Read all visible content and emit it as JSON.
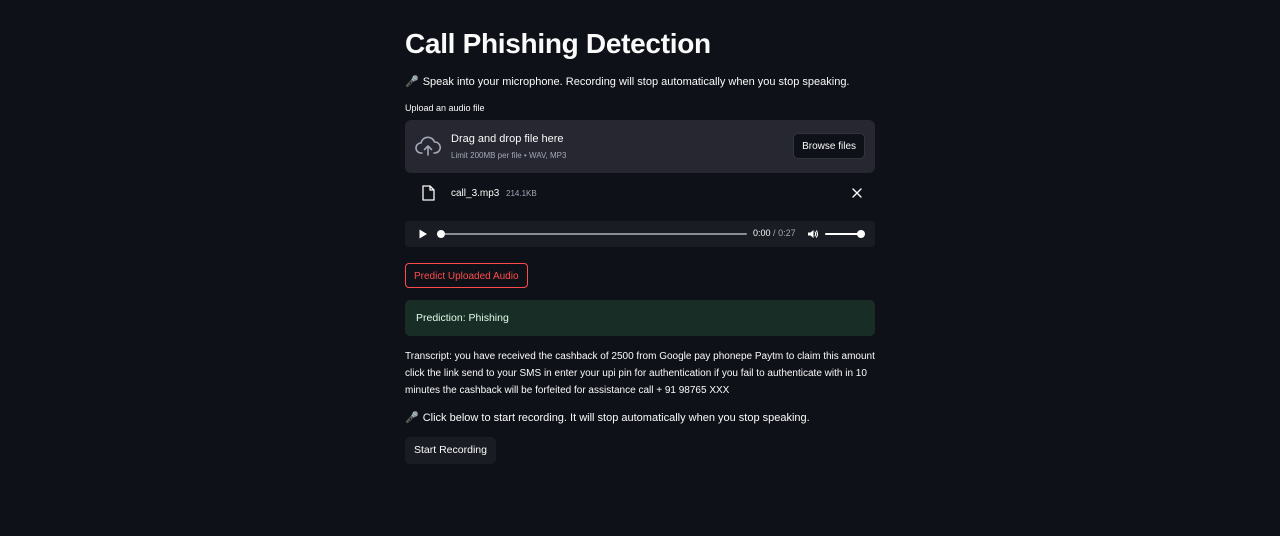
{
  "page": {
    "title": "Call Phishing Detection",
    "intro": "Speak into your microphone. Recording will stop automatically when you stop speaking.",
    "intro_icon": "microphone-icon"
  },
  "uploader": {
    "label": "Upload an audio file",
    "drop_title": "Drag and drop file here",
    "limit": "Limit 200MB per file • WAV, MP3",
    "browse_label": "Browse files",
    "icon": "cloud-upload-icon"
  },
  "uploaded_file": {
    "name": "call_3.mp3",
    "size": "214.1KB",
    "icon": "file-icon"
  },
  "audio_player": {
    "current_time": "0:00",
    "separator": "/",
    "duration": "0:27",
    "progress": 0,
    "volume": 1
  },
  "actions": {
    "predict_label": "Predict Uploaded Audio",
    "record_label": "Start Recording"
  },
  "result": {
    "prediction": "Prediction: Phishing",
    "transcript": "Transcript: you have received the cashback of 2500 from Google pay phonepe Paytm to claim this amount click the link send to your SMS in enter your upi pin for authentication if you fail to authenticate with in 10 minutes the cashback will be forfeited for assistance call + 91 98765 XXX"
  },
  "recording": {
    "info": "Click below to start recording. It will stop automatically when you stop speaking.",
    "icon": "microphone-icon"
  },
  "colors": {
    "background": "#0e1117",
    "accent": "#ff4b4b",
    "success_bg": "#172d26",
    "success_text": "#dffde9"
  }
}
